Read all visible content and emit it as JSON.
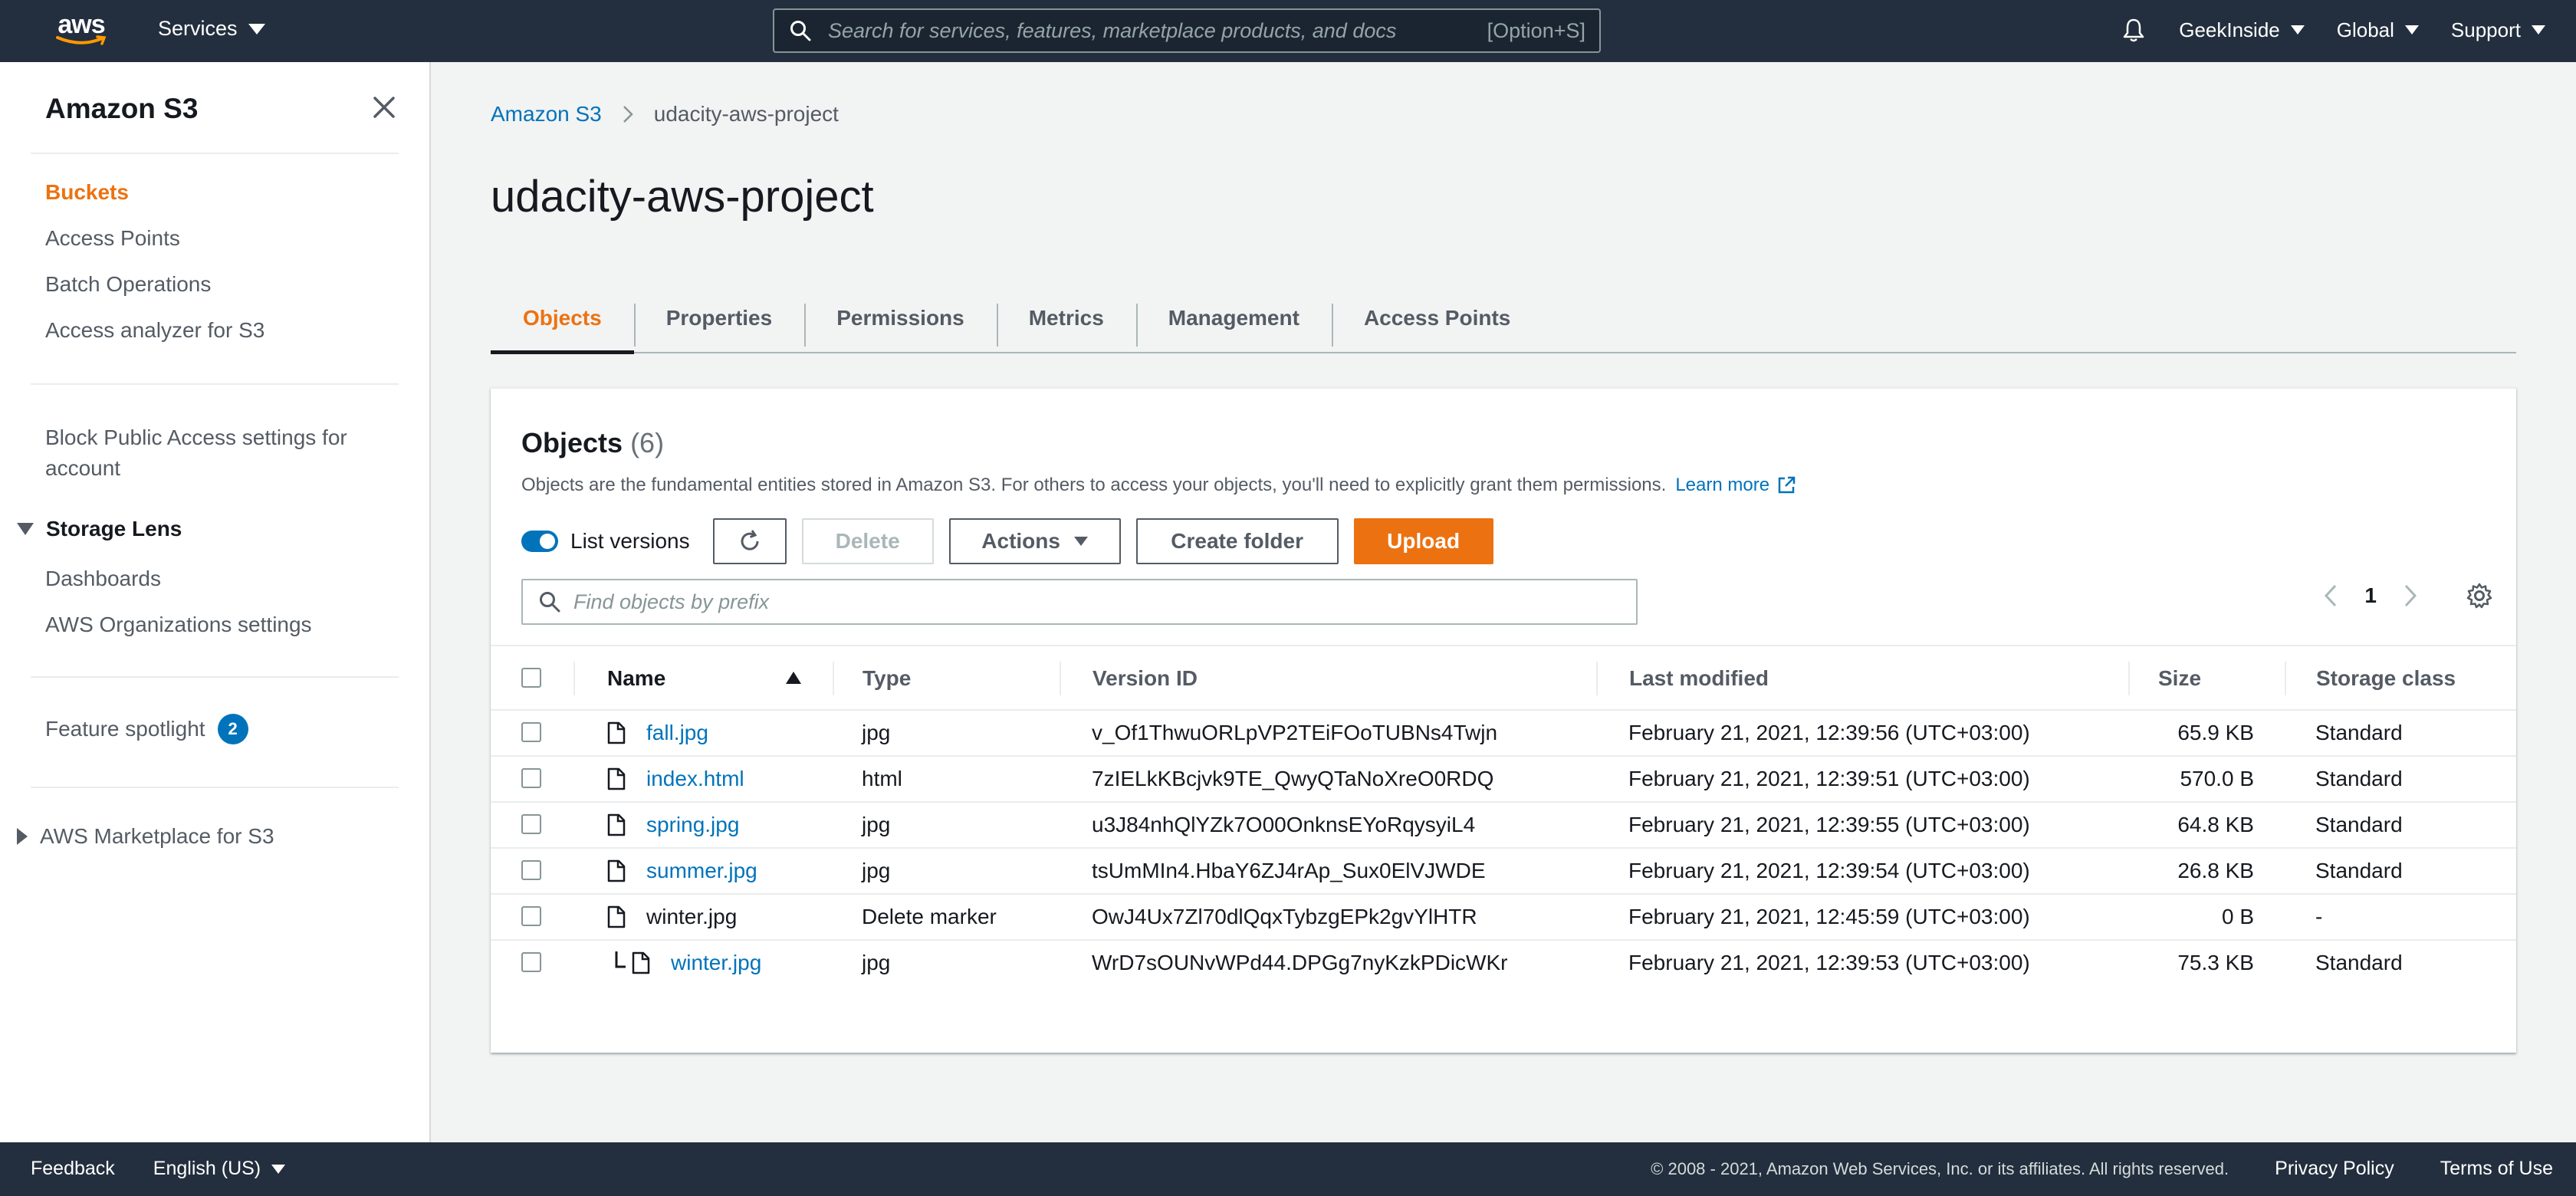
{
  "topnav": {
    "logo_text": "aws",
    "services_label": "Services",
    "search_placeholder": "Search for services, features, marketplace products, and docs",
    "search_shortcut": "[Option+S]",
    "account": "GeekInside",
    "region": "Global",
    "support": "Support"
  },
  "sidebar": {
    "title": "Amazon S3",
    "links": [
      "Buckets",
      "Access Points",
      "Batch Operations",
      "Access analyzer for S3"
    ],
    "block_public_access": "Block Public Access settings for account",
    "storage_lens": {
      "label": "Storage Lens",
      "items": [
        "Dashboards",
        "AWS Organizations settings"
      ]
    },
    "feature_spotlight": "Feature spotlight",
    "feature_spotlight_count": "2",
    "marketplace": "AWS Marketplace for S3"
  },
  "breadcrumb": {
    "root": "Amazon S3",
    "current": "udacity-aws-project"
  },
  "page_title": "udacity-aws-project",
  "tabs": [
    "Objects",
    "Properties",
    "Permissions",
    "Metrics",
    "Management",
    "Access Points"
  ],
  "objects": {
    "title": "Objects",
    "count": "(6)",
    "description": "Objects are the fundamental entities stored in Amazon S3. For others to access your objects, you'll need to explicitly grant them permissions.",
    "learn_more": "Learn more",
    "list_versions": "List versions",
    "buttons": {
      "delete": "Delete",
      "actions": "Actions",
      "create_folder": "Create folder",
      "upload": "Upload"
    },
    "filter_placeholder": "Find objects by prefix",
    "page": "1",
    "columns": [
      "Name",
      "Type",
      "Version ID",
      "Last modified",
      "Size",
      "Storage class"
    ],
    "rows": [
      {
        "name": "fall.jpg",
        "type": "jpg",
        "version": "v_Of1ThwuORLpVP2TEiFOoTUBNs4Twjn",
        "modified": "February 21, 2021, 12:39:56 (UTC+03:00)",
        "size": "65.9 KB",
        "storage": "Standard"
      },
      {
        "name": "index.html",
        "type": "html",
        "version": "7zIELkKBcjvk9TE_QwyQTaNoXreO0RDQ",
        "modified": "February 21, 2021, 12:39:51 (UTC+03:00)",
        "size": "570.0 B",
        "storage": "Standard"
      },
      {
        "name": "spring.jpg",
        "type": "jpg",
        "version": "u3J84nhQlYZk7O00OnknsEYoRqysyiL4",
        "modified": "February 21, 2021, 12:39:55 (UTC+03:00)",
        "size": "64.8 KB",
        "storage": "Standard"
      },
      {
        "name": "summer.jpg",
        "type": "jpg",
        "version": "tsUmMIn4.HbaY6ZJ4rAp_Sux0ElVJWDE",
        "modified": "February 21, 2021, 12:39:54 (UTC+03:00)",
        "size": "26.8 KB",
        "storage": "Standard"
      },
      {
        "name": "winter.jpg",
        "type": "Delete marker",
        "version": "OwJ4Ux7Zl70dlQqxTybzgEPk2gvYlHTR",
        "modified": "February 21, 2021, 12:45:59 (UTC+03:00)",
        "size": "0 B",
        "storage": "-"
      },
      {
        "name": "winter.jpg",
        "type": "jpg",
        "version": "WrD7sOUNvWPd44.DPGg7nyKzkPDicWKr",
        "modified": "February 21, 2021, 12:39:53 (UTC+03:00)",
        "size": "75.3 KB",
        "storage": "Standard"
      }
    ]
  },
  "footer": {
    "feedback": "Feedback",
    "language": "English (US)",
    "copyright": "© 2008 - 2021, Amazon Web Services, Inc. or its affiliates. All rights reserved.",
    "privacy": "Privacy Policy",
    "terms": "Terms of Use"
  },
  "colors": {
    "nav_bg": "#232f3e",
    "accent_orange": "#ec7211",
    "link_blue": "#0073bb"
  }
}
